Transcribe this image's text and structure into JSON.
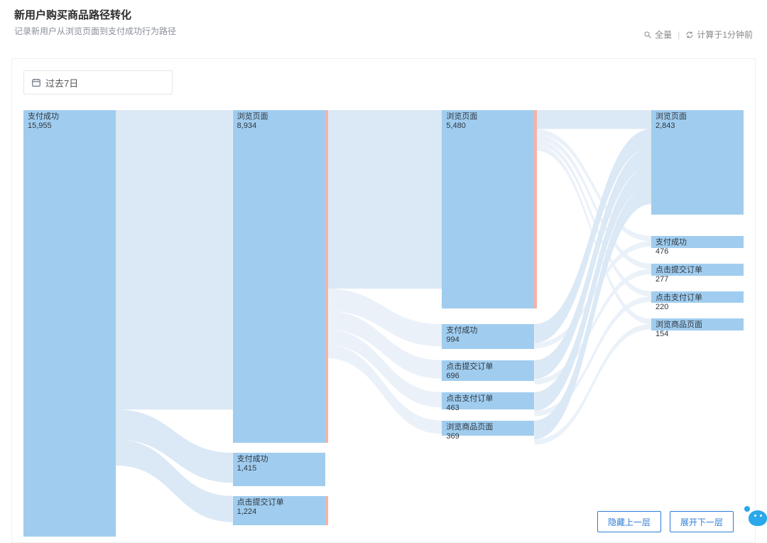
{
  "header": {
    "title": "新用户购买商品路径转化",
    "subtitle": "记录新用户从浏览页面到支付成功行为路径",
    "scope_label": "全量",
    "computed_label": "计算于1分钟前"
  },
  "toolbar": {
    "date_range_label": "过去7日"
  },
  "actions": {
    "hide_prev_label": "隐藏上一层",
    "expand_next_label": "展开下一层"
  },
  "chart_data": {
    "type": "sankey",
    "title": "新用户购买商品路径转化",
    "levels": 4,
    "nodes": [
      {
        "id": "l0_paysucc",
        "level": 0,
        "name": "支付成功",
        "value": 15955
      },
      {
        "id": "l1_browse",
        "level": 1,
        "name": "浏览页面",
        "value": 8934
      },
      {
        "id": "l1_paysucc",
        "level": 1,
        "name": "支付成功",
        "value": 1415
      },
      {
        "id": "l1_submit",
        "level": 1,
        "name": "点击提交订单",
        "value": 1224
      },
      {
        "id": "l2_browse",
        "level": 2,
        "name": "浏览页面",
        "value": 5480
      },
      {
        "id": "l2_paysucc",
        "level": 2,
        "name": "支付成功",
        "value": 994
      },
      {
        "id": "l2_submit",
        "level": 2,
        "name": "点击提交订单",
        "value": 696
      },
      {
        "id": "l2_payorder",
        "level": 2,
        "name": "点击支付订单",
        "value": 463
      },
      {
        "id": "l2_goods",
        "level": 2,
        "name": "浏览商品页面",
        "value": 369
      },
      {
        "id": "l3_browse",
        "level": 3,
        "name": "浏览页面",
        "value": 2843
      },
      {
        "id": "l3_paysucc",
        "level": 3,
        "name": "支付成功",
        "value": 476
      },
      {
        "id": "l3_submit",
        "level": 3,
        "name": "点击提交订单",
        "value": 277
      },
      {
        "id": "l3_payorder",
        "level": 3,
        "name": "点击支付订单",
        "value": 220
      },
      {
        "id": "l3_goods",
        "level": 3,
        "name": "浏览商品页面",
        "value": 154
      }
    ],
    "links": [
      {
        "source": "l0_paysucc",
        "target": "l1_browse"
      },
      {
        "source": "l0_paysucc",
        "target": "l1_paysucc"
      },
      {
        "source": "l0_paysucc",
        "target": "l1_submit"
      },
      {
        "source": "l1_browse",
        "target": "l2_browse"
      },
      {
        "source": "l1_browse",
        "target": "l2_paysucc"
      },
      {
        "source": "l1_browse",
        "target": "l2_submit"
      },
      {
        "source": "l1_browse",
        "target": "l2_payorder"
      },
      {
        "source": "l1_browse",
        "target": "l2_goods"
      },
      {
        "source": "l2_browse",
        "target": "l3_browse"
      },
      {
        "source": "l2_browse",
        "target": "l3_paysucc"
      },
      {
        "source": "l2_browse",
        "target": "l3_submit"
      },
      {
        "source": "l2_browse",
        "target": "l3_payorder"
      },
      {
        "source": "l2_browse",
        "target": "l3_goods"
      },
      {
        "source": "l2_paysucc",
        "target": "l3_browse"
      },
      {
        "source": "l2_paysucc",
        "target": "l3_paysucc"
      },
      {
        "source": "l2_submit",
        "target": "l3_browse"
      },
      {
        "source": "l2_submit",
        "target": "l3_submit"
      },
      {
        "source": "l2_payorder",
        "target": "l3_browse"
      },
      {
        "source": "l2_payorder",
        "target": "l3_payorder"
      },
      {
        "source": "l2_goods",
        "target": "l3_browse"
      },
      {
        "source": "l2_goods",
        "target": "l3_goods"
      }
    ]
  }
}
